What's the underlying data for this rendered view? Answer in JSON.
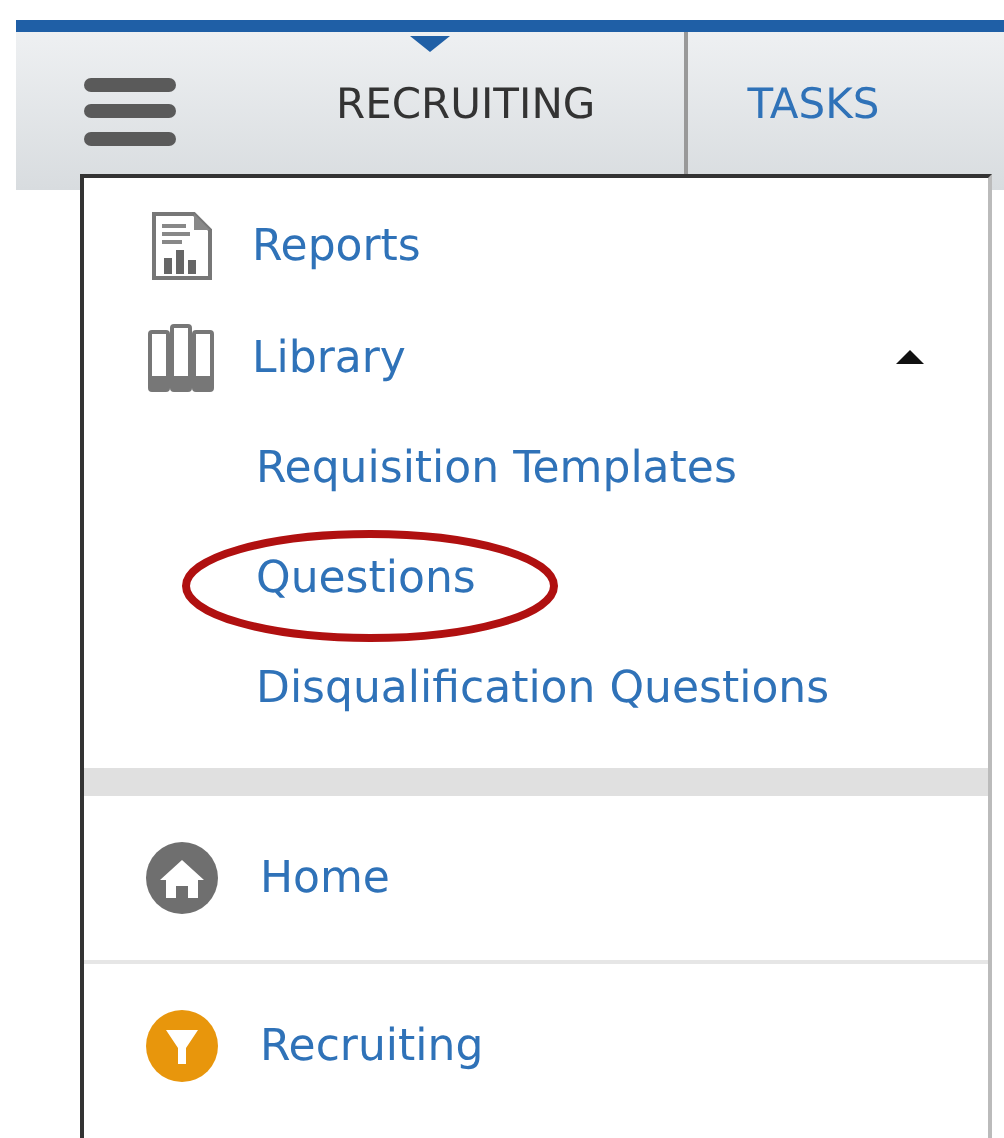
{
  "header": {
    "tabs": [
      {
        "label": "RECRUITING",
        "selected": true
      },
      {
        "label": "TASKS",
        "selected": false
      }
    ]
  },
  "menu": {
    "sections": [
      {
        "kind": "tools",
        "items": [
          {
            "label": "Reports",
            "kind": "reports"
          },
          {
            "label": "Library",
            "kind": "library",
            "expanded": true,
            "children": [
              {
                "label": "Requisition Templates",
                "circled": false
              },
              {
                "label": "Questions",
                "circled": true
              },
              {
                "label": "Disqualification Questions",
                "circled": false
              }
            ]
          }
        ]
      },
      {
        "kind": "modules",
        "items": [
          {
            "label": "Home",
            "kind": "home"
          },
          {
            "label": "Recruiting",
            "kind": "recruiting"
          }
        ]
      }
    ]
  }
}
